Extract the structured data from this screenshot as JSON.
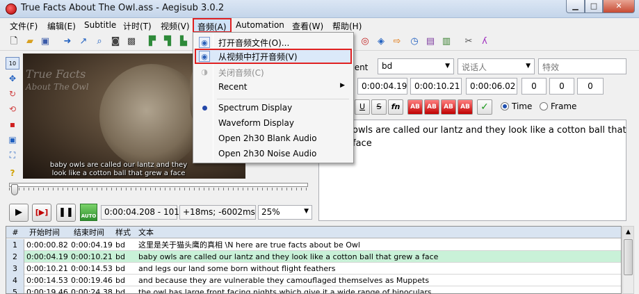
{
  "window": {
    "title": "True Facts About The Owl.ass - Aegisub 3.0.2",
    "minimize": "▁",
    "maximize": "□",
    "close": "✕"
  },
  "menubar": {
    "items": [
      "文件(F)",
      "编辑(E)",
      "Subtitle",
      "计时(T)",
      "视频(V)",
      "音频(A)",
      "Automation",
      "查看(W)",
      "帮助(H)"
    ],
    "active": "音频(A)"
  },
  "audio_menu": {
    "items": [
      {
        "label": "打开音频文件(O)...",
        "icon": "audio-icon",
        "enabled": true
      },
      {
        "label": "从视频中打开音频(V)",
        "icon": "audio-video-icon",
        "enabled": true,
        "highlighted": true
      },
      {
        "label": "关闭音频(C)",
        "icon": "audio-close-icon",
        "enabled": false
      },
      {
        "label": "Recent",
        "submenu": true
      },
      {
        "label": "Spectrum Display",
        "checked": true
      },
      {
        "label": "Waveform Display"
      },
      {
        "label": "Open 2h30 Blank Audio"
      },
      {
        "label": "Open 2h30 Noise Audio"
      }
    ]
  },
  "video": {
    "watermark_line1": "True Facts",
    "watermark_line2": "About The Owl",
    "subtitle_line1": "baby owls are called our lantz and they",
    "subtitle_line2": "look like a cotton ball that grew a face"
  },
  "playback": {
    "auto_label": "AUTO",
    "time_frame": "0:00:04.208 - 101",
    "offset": "+18ms; -6002ms",
    "zoom": "25%"
  },
  "edit": {
    "label_partial": "ment",
    "style": "bd",
    "actor_placeholder": "说话人",
    "effect_placeholder": "特效",
    "start": "0:00:04.19",
    "end": "0:00:10.21",
    "duration": "0:00:06.02",
    "margin_l": "0",
    "margin_r": "0",
    "margin_v": "0",
    "format_buttons": [
      "U",
      "S",
      "fn",
      "AB",
      "AB",
      "AB",
      "AB",
      "✓"
    ],
    "time_option": "Time",
    "frame_option": "Frame",
    "text_line1": "owls are called our lantz and they look like a cotton ball that",
    "text_line2": "face"
  },
  "grid": {
    "headers": [
      "#",
      "开始时间",
      "结束时间",
      "样式",
      "文本"
    ],
    "rows": [
      {
        "num": "1",
        "start": "0:00:00.82",
        "end": "0:00:04.19",
        "style": "bd",
        "text": "这里是关于猫头鹰的真相 \\N here are true facts about be Owl"
      },
      {
        "num": "2",
        "start": "0:00:04.19",
        "end": "0:00:10.21",
        "style": "bd",
        "text": "baby owls are called our lantz and they look like a cotton ball that grew a face"
      },
      {
        "num": "3",
        "start": "0:00:10.21",
        "end": "0:00:14.53",
        "style": "bd",
        "text": "and legs our land some born without flight feathers"
      },
      {
        "num": "4",
        "start": "0:00:14.53",
        "end": "0:00:19.46",
        "style": "bd",
        "text": "and because they are vulnerable they camouflaged themselves as Muppets"
      },
      {
        "num": "5",
        "start": "0:00:19.46",
        "end": "0:00:24.38",
        "style": "bd",
        "text": "the owl has large front facing nights which give it a wide range of binoculars"
      }
    ],
    "selected_row": 1
  }
}
